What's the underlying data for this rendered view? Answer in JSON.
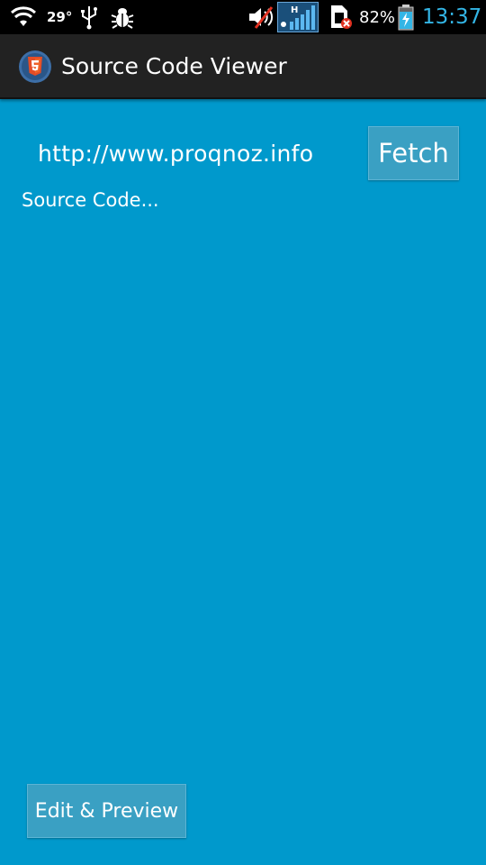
{
  "status_bar": {
    "temperature": "29°",
    "battery_percent": "82%",
    "clock": "13:37",
    "network_label": "H",
    "icons": [
      "wifi-icon",
      "usb-icon",
      "debug-bug-icon",
      "mute-icon",
      "signal-icon",
      "sim-error-icon",
      "battery-charging-icon"
    ],
    "clock_color": "#33b5e5"
  },
  "action_bar": {
    "title": "Source Code Viewer",
    "icon": "html5-app-icon"
  },
  "main": {
    "url_value": "http://www.proqnoz.info",
    "fetch_label": "Fetch",
    "source_text": "Source Code...",
    "edit_preview_label": "Edit & Preview",
    "background_color": "#0099cc"
  }
}
